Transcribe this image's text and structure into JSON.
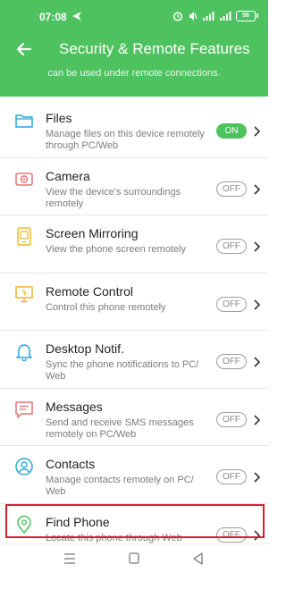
{
  "status": {
    "time": "07:08",
    "battery": "56",
    "network_label": "46"
  },
  "header": {
    "title": "Security & Remote Features",
    "subtitle": "can be used under remote connections."
  },
  "items": [
    {
      "title": "Files",
      "desc": "Manage files on this device remotely through PC/Web",
      "toggle": "ON",
      "state": "on",
      "icon": "folder-icon"
    },
    {
      "title": "Camera",
      "desc": "View the device's surroundings remotely",
      "toggle": "OFF",
      "state": "off",
      "icon": "camera-icon"
    },
    {
      "title": "Screen Mirroring",
      "desc": "View the phone screen remotely",
      "toggle": "OFF",
      "state": "off",
      "icon": "screen-mirroring-icon"
    },
    {
      "title": "Remote Control",
      "desc": "Control this phone remotely",
      "toggle": "OFF",
      "state": "off",
      "icon": "remote-control-icon"
    },
    {
      "title": "Desktop Notif.",
      "desc": "Sync the phone notifications to PC/ Web",
      "toggle": "OFF",
      "state": "off",
      "icon": "bell-icon"
    },
    {
      "title": "Messages",
      "desc": "Send and receive SMS messages remotely on PC/Web",
      "toggle": "OFF",
      "state": "off",
      "icon": "message-icon"
    },
    {
      "title": "Contacts",
      "desc": "Manage contacts remotely on PC/ Web",
      "toggle": "OFF",
      "state": "off",
      "icon": "contacts-icon"
    },
    {
      "title": "Find Phone",
      "desc": "Locate this phone through Web",
      "toggle": "OFF",
      "state": "off",
      "icon": "location-pin-icon"
    }
  ],
  "colors": {
    "accent": "#4ec25f",
    "highlight": "#d3212d",
    "files_icon": "#29a6d6",
    "camera_icon": "#e57373",
    "screen_icon": "#f3b72a",
    "remote_icon": "#f3b72a",
    "bell_icon": "#29a6d6",
    "message_icon": "#e57373",
    "contacts_icon": "#29a6d6",
    "location_icon": "#4ec25f"
  },
  "navbar": {
    "icons": [
      "menu-icon",
      "home-square-icon",
      "back-triangle-icon"
    ]
  }
}
